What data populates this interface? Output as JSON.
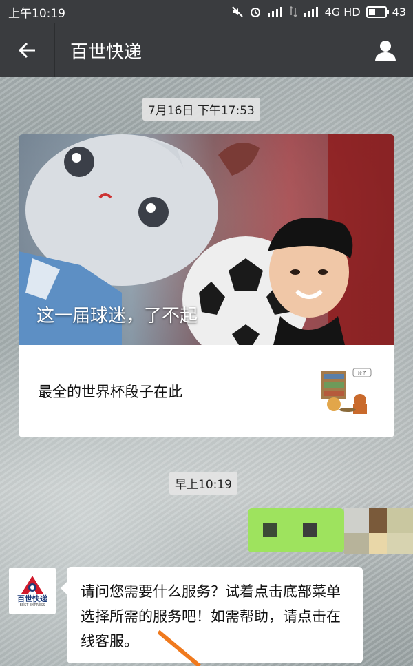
{
  "status_bar": {
    "time": "上午10:19",
    "network": "4G HD",
    "battery": "43"
  },
  "nav": {
    "title": "百世快递"
  },
  "chat": {
    "timestamp_1": "7月16日 下午17:53",
    "article": {
      "headline": "这一届球迷，了不起",
      "description": "最全的世界杯段子在此",
      "thumbnail_caption": "段子"
    },
    "timestamp_2": "早上10:19",
    "incoming_message": "请问您需要什么服务？试着点击底部菜单选择所需的服务吧！如需帮助，请点击在线客服。",
    "sender_logo": {
      "name": "百世快递",
      "subtitle": "BEST EXPRESS"
    }
  },
  "colors": {
    "bar_bg": "#3a3c3f",
    "outgoing_bubble": "#9ee35e",
    "logo_red": "#d0192b"
  }
}
